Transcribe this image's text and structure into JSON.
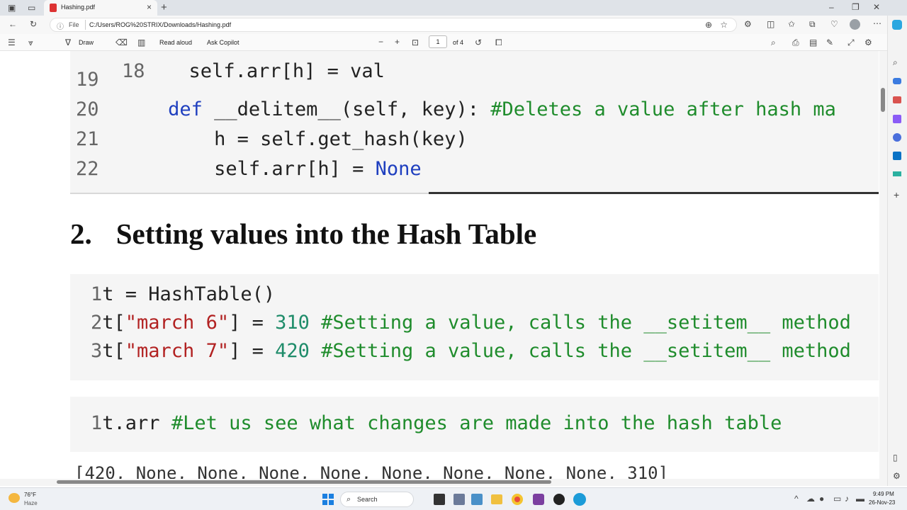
{
  "browser": {
    "tab_title": "Hashing.pdf",
    "url_scheme_label": "File",
    "url": "C:/Users/ROG%20STRIX/Downloads/Hashing.pdf"
  },
  "pdf_toolbar": {
    "draw_label": "Draw",
    "read_aloud_label": "Read aloud",
    "ask_copilot_label": "Ask Copilot",
    "page_current": "1",
    "page_total": "of 4"
  },
  "document": {
    "top_code": {
      "partial_line": "self.arr[h] = val",
      "lines": [
        {
          "no": "19",
          "indent": "",
          "segments": []
        },
        {
          "no": "20",
          "indent": "    ",
          "segments": [
            {
              "t": "def",
              "c": "kw"
            },
            {
              "t": " __delitem__(self, key): ",
              "c": ""
            },
            {
              "t": "#Deletes a value after hash ma",
              "c": "cm"
            }
          ]
        },
        {
          "no": "21",
          "indent": "        ",
          "segments": [
            {
              "t": "h = self.get_hash(key)",
              "c": ""
            }
          ]
        },
        {
          "no": "22",
          "indent": "        ",
          "segments": [
            {
              "t": "self.arr[h] = ",
              "c": ""
            },
            {
              "t": "None",
              "c": "none"
            }
          ]
        }
      ]
    },
    "section_heading_number": "2.",
    "section_heading_text": "Setting values into the Hash Table",
    "code_block_1": [
      {
        "no": "1",
        "segments": [
          {
            "t": "t = HashTable()",
            "c": ""
          }
        ]
      },
      {
        "no": "2",
        "segments": [
          {
            "t": "t[",
            "c": ""
          },
          {
            "t": "\"march 6\"",
            "c": "str"
          },
          {
            "t": "] = ",
            "c": ""
          },
          {
            "t": "310",
            "c": "num"
          },
          {
            "t": " #Setting a value, calls the __setitem__ method",
            "c": "cm"
          }
        ]
      },
      {
        "no": "3",
        "segments": [
          {
            "t": "t[",
            "c": ""
          },
          {
            "t": "\"march 7\"",
            "c": "str"
          },
          {
            "t": "] = ",
            "c": ""
          },
          {
            "t": "420",
            "c": "num"
          },
          {
            "t": " #Setting a value, calls the __setitem__ method",
            "c": "cm"
          }
        ]
      }
    ],
    "code_block_2": [
      {
        "no": "1",
        "segments": [
          {
            "t": "t.arr ",
            "c": ""
          },
          {
            "t": "#Let us see what changes are made into the hash table",
            "c": "cm"
          }
        ]
      }
    ],
    "output_line": "[420, None, None, None, None, None, None, None, None, 310]"
  },
  "taskbar": {
    "weather_temp": "76°F",
    "weather_desc": "Haze",
    "search_label": "Search",
    "time": "9:49 PM",
    "date": "26-Nov-23"
  },
  "colors": {
    "keyword": "#1f3fbf",
    "comment": "#1f8c2c",
    "string": "#b22222",
    "number": "#1f8c6a"
  }
}
